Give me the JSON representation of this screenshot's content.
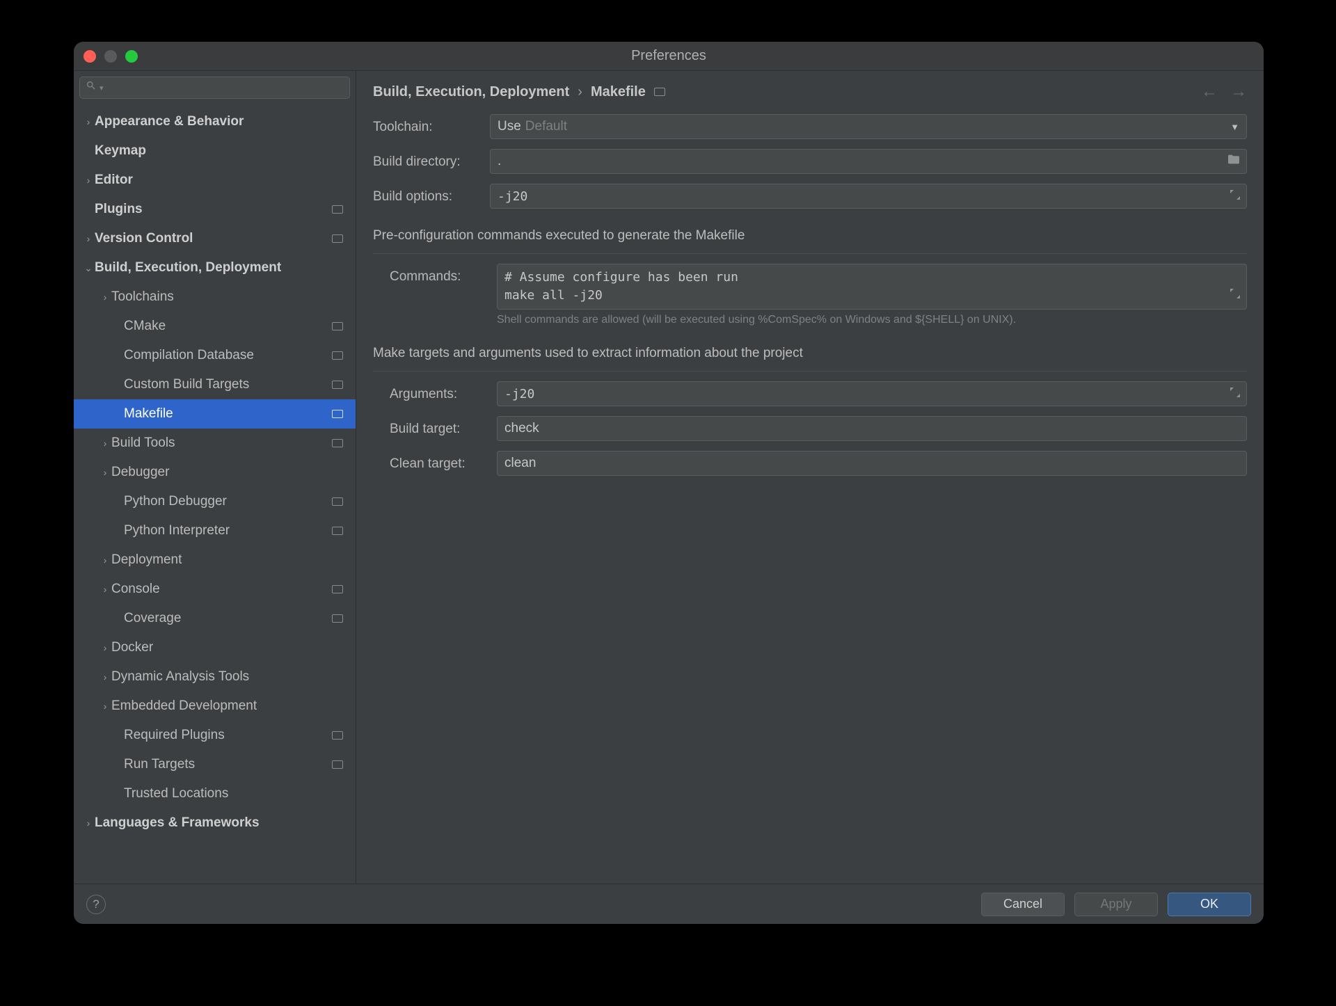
{
  "window": {
    "title": "Preferences"
  },
  "breadcrumb": {
    "root": "Build, Execution, Deployment",
    "leaf": "Makefile",
    "sep": "›"
  },
  "sidebar": {
    "items": [
      {
        "label": "Appearance & Behavior",
        "level": 0,
        "expand": "right",
        "bold": true
      },
      {
        "label": "Keymap",
        "level": 0,
        "expand": "",
        "bold": true
      },
      {
        "label": "Editor",
        "level": 0,
        "expand": "right",
        "bold": true
      },
      {
        "label": "Plugins",
        "level": 0,
        "expand": "",
        "bold": true,
        "project": true
      },
      {
        "label": "Version Control",
        "level": 0,
        "expand": "right",
        "bold": true,
        "project": true
      },
      {
        "label": "Build, Execution, Deployment",
        "level": 0,
        "expand": "down",
        "bold": true
      },
      {
        "label": "Toolchains",
        "level": 1,
        "expand": "right"
      },
      {
        "label": "CMake",
        "level": 1,
        "expand": "",
        "project": true,
        "pad": true
      },
      {
        "label": "Compilation Database",
        "level": 1,
        "expand": "",
        "project": true,
        "pad": true
      },
      {
        "label": "Custom Build Targets",
        "level": 1,
        "expand": "",
        "project": true,
        "pad": true
      },
      {
        "label": "Makefile",
        "level": 1,
        "expand": "",
        "project": true,
        "pad": true,
        "selected": true
      },
      {
        "label": "Build Tools",
        "level": 1,
        "expand": "right",
        "project": true
      },
      {
        "label": "Debugger",
        "level": 1,
        "expand": "right"
      },
      {
        "label": "Python Debugger",
        "level": 1,
        "expand": "",
        "project": true,
        "pad": true
      },
      {
        "label": "Python Interpreter",
        "level": 1,
        "expand": "",
        "project": true,
        "pad": true
      },
      {
        "label": "Deployment",
        "level": 1,
        "expand": "right"
      },
      {
        "label": "Console",
        "level": 1,
        "expand": "right",
        "project": true
      },
      {
        "label": "Coverage",
        "level": 1,
        "expand": "",
        "project": true,
        "pad": true
      },
      {
        "label": "Docker",
        "level": 1,
        "expand": "right"
      },
      {
        "label": "Dynamic Analysis Tools",
        "level": 1,
        "expand": "right"
      },
      {
        "label": "Embedded Development",
        "level": 1,
        "expand": "right"
      },
      {
        "label": "Required Plugins",
        "level": 1,
        "expand": "",
        "project": true,
        "pad": true
      },
      {
        "label": "Run Targets",
        "level": 1,
        "expand": "",
        "project": true,
        "pad": true
      },
      {
        "label": "Trusted Locations",
        "level": 1,
        "expand": "",
        "pad": true
      },
      {
        "label": "Languages & Frameworks",
        "level": 0,
        "expand": "right",
        "bold": true
      }
    ]
  },
  "form": {
    "toolchain": {
      "label": "Toolchain:",
      "prefix": "Use",
      "value": "Default"
    },
    "build_dir": {
      "label": "Build directory:",
      "value": "."
    },
    "build_opts": {
      "label": "Build options:",
      "value": "-j20"
    },
    "preconf_section": "Pre-configuration commands executed to generate the Makefile",
    "commands": {
      "label": "Commands:",
      "value": "# Assume configure has been run\nmake all -j20",
      "help": "Shell commands are allowed (will be executed using %ComSpec% on Windows and ${SHELL} on UNIX)."
    },
    "targets_section": "Make targets and arguments used to extract information about the project",
    "arguments": {
      "label": "Arguments:",
      "value": "-j20"
    },
    "build_target": {
      "label": "Build target:",
      "value": "check"
    },
    "clean_target": {
      "label": "Clean target:",
      "value": "clean"
    }
  },
  "footer": {
    "cancel": "Cancel",
    "apply": "Apply",
    "ok": "OK"
  }
}
